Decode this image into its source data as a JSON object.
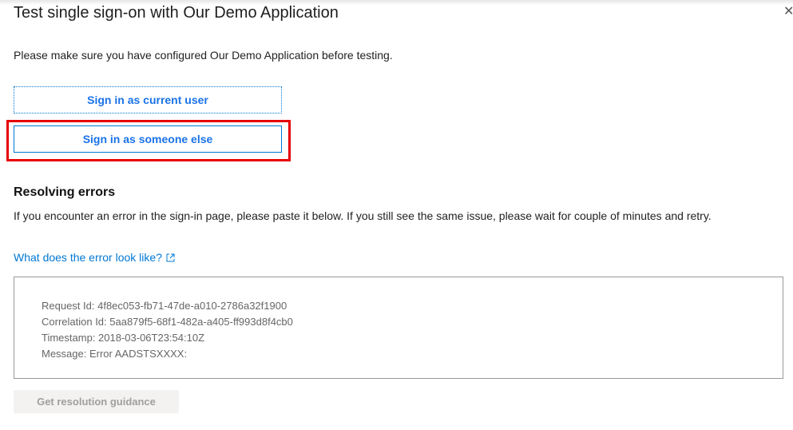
{
  "panel": {
    "title": "Test single sign-on with Our Demo Application",
    "close_icon": "close-icon",
    "intro": "Please make sure you have configured Our Demo Application before testing.",
    "sign_in_current_label": "Sign in as current user",
    "sign_in_else_label": "Sign in as someone else",
    "highlight_color": "#e60000"
  },
  "resolving": {
    "heading": "Resolving errors",
    "description": "If you encounter an error in the sign-in page, please paste it below. If you still see the same issue, please wait for couple of minutes and retry.",
    "link_label": "What does the error look like?",
    "link_icon": "external-link-icon",
    "error_lines": [
      "Request Id: 4f8ec053-fb71-47de-a010-2786a32f1900",
      "Correlation Id: 5aa879f5-68f1-482a-a405-ff993d8f4cb0",
      "Timestamp: 2018-03-06T23:54:10Z",
      "Message: Error AADSTSXXXX:"
    ],
    "guidance_label": "Get resolution guidance"
  }
}
